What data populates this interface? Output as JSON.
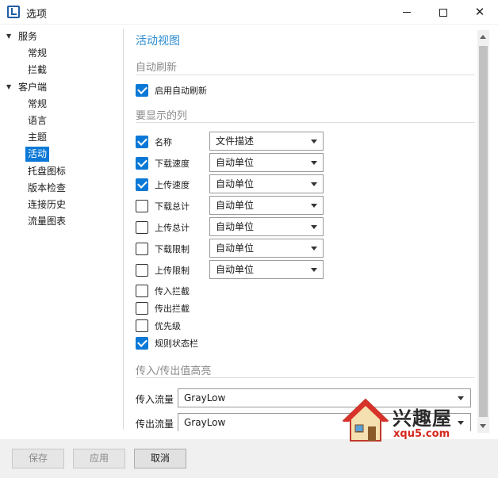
{
  "window": {
    "title": "选项"
  },
  "tree": {
    "services": {
      "label": "服务",
      "children": [
        "常规",
        "拦截"
      ]
    },
    "client": {
      "label": "客户端",
      "children": [
        "常规",
        "语言",
        "主题",
        "活动",
        "托盘图标",
        "版本检查",
        "连接历史",
        "流量图表"
      ]
    },
    "selected": "活动"
  },
  "panel": {
    "heading": "活动视图",
    "auto_refresh": {
      "section": "自动刷新",
      "enable_label": "启用自动刷新",
      "enable_checked": true
    },
    "columns": {
      "section": "要显示的列",
      "rows": [
        {
          "label": "名称",
          "checked": true,
          "value": "文件描述"
        },
        {
          "label": "下载速度",
          "checked": true,
          "value": "自动单位"
        },
        {
          "label": "上传速度",
          "checked": true,
          "value": "自动单位"
        },
        {
          "label": "下载总计",
          "checked": false,
          "value": "自动单位"
        },
        {
          "label": "上传总计",
          "checked": false,
          "value": "自动单位"
        },
        {
          "label": "下载限制",
          "checked": false,
          "value": "自动单位"
        },
        {
          "label": "上传限制",
          "checked": false,
          "value": "自动单位"
        }
      ],
      "extra": [
        {
          "label": "传入拦截",
          "checked": false
        },
        {
          "label": "传出拦截",
          "checked": false
        },
        {
          "label": "优先级",
          "checked": false
        },
        {
          "label": "规则状态栏",
          "checked": true
        }
      ]
    },
    "highlight": {
      "section": "传入/传出值高亮",
      "incoming_label": "传入流量",
      "incoming_value": "GrayLow",
      "outgoing_label": "传出流量",
      "outgoing_value": "GrayLow"
    }
  },
  "footer": {
    "save": "保存",
    "apply": "应用",
    "cancel": "取消"
  },
  "watermark": {
    "brand": "兴趣屋",
    "url": "xqu5.com"
  },
  "colors": {
    "accent": "#0a78d7",
    "heading": "#2a8bd0"
  }
}
